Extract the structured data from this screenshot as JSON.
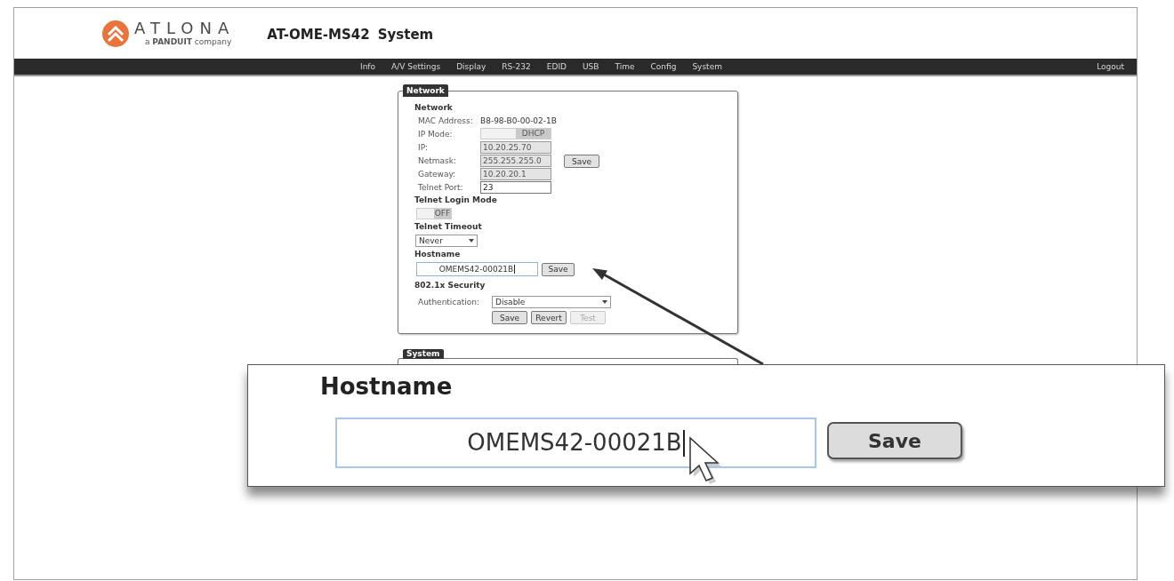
{
  "header": {
    "logo": {
      "wordmark": "ATLONA",
      "tagline": "a **PANDUIT** company"
    },
    "model": "AT-OME-MS42",
    "page": "System"
  },
  "nav": {
    "items": [
      "Info",
      "A/V Settings",
      "Display",
      "RS-232",
      "EDID",
      "USB",
      "Time",
      "Config",
      "System"
    ],
    "logout": "Logout"
  },
  "network_panel": {
    "legend": "Network",
    "network": {
      "heading": "Network",
      "rows": [
        {
          "kind": "text",
          "label": "MAC Address:",
          "value": "B8-98-B0-00-02-1B"
        },
        {
          "kind": "toggle",
          "label": "IP Mode:",
          "value": "DHCP"
        },
        {
          "kind": "input",
          "label": "IP:",
          "value": "10.20.25.70",
          "disabled": true
        },
        {
          "kind": "input",
          "label": "Netmask:",
          "value": "255.255.255.0",
          "disabled": true
        },
        {
          "kind": "input",
          "label": "Gateway:",
          "value": "10.20.20.1",
          "disabled": true
        },
        {
          "kind": "input",
          "label": "Telnet Port:",
          "value": "23",
          "disabled": false
        }
      ],
      "save": "Save"
    },
    "telnet_login_mode": {
      "heading": "Telnet Login Mode",
      "toggle": "OFF"
    },
    "telnet_timeout": {
      "heading": "Telnet Timeout",
      "select": "Never"
    },
    "hostname": {
      "heading": "Hostname",
      "value": "OMEMS42-00021B",
      "focused": true,
      "save": "Save"
    },
    "security": {
      "heading": "802.1x Security",
      "label": "Authentication:",
      "select": "Disable",
      "buttons": [
        {
          "label": "Save",
          "disabled": false
        },
        {
          "label": "Revert",
          "disabled": false
        },
        {
          "label": "Test",
          "disabled": true
        }
      ]
    }
  },
  "system_panel": {
    "legend": "System"
  },
  "callout": {
    "heading": "Hostname",
    "value": "OMEMS42-00021B",
    "focused": true,
    "save": "Save"
  }
}
